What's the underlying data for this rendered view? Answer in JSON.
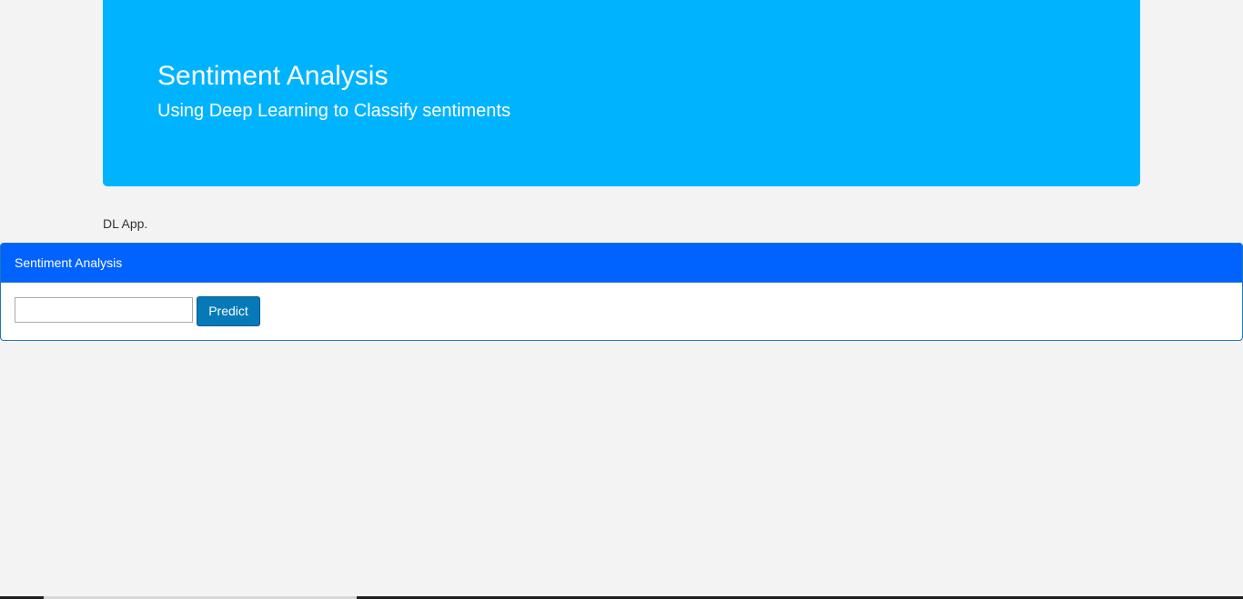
{
  "jumbotron": {
    "title": "Sentiment Analysis",
    "subtitle": "Using Deep Learning to Classify sentiments"
  },
  "app_label": "DL App.",
  "panel": {
    "heading": "Sentiment Analysis",
    "input": {
      "value": "",
      "placeholder": ""
    },
    "predict_label": "Predict"
  },
  "colors": {
    "jumbotron_bg": "#00b3ff",
    "panel_heading_bg": "#0062ff",
    "button_bg": "#067ab8",
    "page_bg": "#f3f3f3"
  }
}
